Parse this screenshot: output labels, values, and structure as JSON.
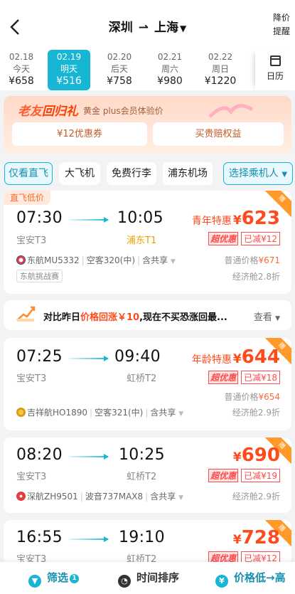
{
  "header": {
    "from": "深圳",
    "to": "上海",
    "price_watch": "降价提醒"
  },
  "dates": [
    {
      "date": "02.18",
      "day": "今天",
      "price": "¥658"
    },
    {
      "date": "02.19",
      "day": "明天",
      "price": "¥516",
      "selected": true
    },
    {
      "date": "02.20",
      "day": "后天",
      "price": "¥758"
    },
    {
      "date": "02.21",
      "day": "周六",
      "price": "¥980"
    },
    {
      "date": "02.22",
      "day": "周日",
      "price": "¥1220"
    }
  ],
  "calendar_label": "日历",
  "promo": {
    "title_a": "老友",
    "title_b": "回归礼",
    "subtitle": "黄金 plus会员体验价",
    "coupon": "¥12优惠券",
    "guarantee": "买贵赔权益"
  },
  "filters": [
    "仅看直飞",
    "大飞机",
    "免费行李",
    "浦东机场"
  ],
  "passenger_select": "选择乘机人",
  "flights": [
    {
      "tag": "直飞低价",
      "dep_time": "07:30",
      "dep_airport": "宝安T3",
      "arr_time": "10:05",
      "arr_airport": "浦东T1",
      "price_label": "青年特惠",
      "price": "623",
      "badge1": "超优惠",
      "badge2": "已减¥12",
      "airline": "东航MU5332",
      "aircraft": "空客320(中)",
      "share": "含共享",
      "normal_label": "普通价格",
      "normal_price": "¥671",
      "cabin": "经济舱2.8折",
      "event": "东航挑战赛",
      "corner": "赠"
    },
    {
      "dep_time": "07:25",
      "dep_airport": "宝安T3",
      "arr_time": "09:40",
      "arr_airport": "虹桥T2",
      "price_label": "年龄特惠",
      "price": "644",
      "badge1": "超优惠",
      "badge2": "已减¥18",
      "airline": "吉祥航HO1890",
      "aircraft": "空客321(中)",
      "share": "含共享",
      "normal_label": "普通价格",
      "normal_price": "¥654",
      "cabin": "经济舱2.9折",
      "corner": "赠"
    },
    {
      "dep_time": "08:20",
      "dep_airport": "宝安T3",
      "arr_time": "10:25",
      "arr_airport": "虹桥T2",
      "price": "690",
      "badge1": "超优惠",
      "badge2": "已减¥19",
      "airline": "深航ZH9501",
      "aircraft": "波音737MAX8",
      "share": "含共享",
      "cabin": "经济舱2.9折",
      "corner": "赠"
    },
    {
      "dep_time": "16:55",
      "dep_airport": "宝安T3",
      "arr_time": "19:10",
      "arr_airport": "虹桥T2",
      "price": "728",
      "badge1": "超优惠",
      "badge2": "已减¥12",
      "corner": "赠"
    }
  ],
  "notice": {
    "prefix": "对比昨日",
    "red": "价格回涨￥10",
    "suffix": ",现在不买恐涨回最...",
    "more": "查看"
  },
  "bottom": {
    "filter": "筛选",
    "filter_count": "1",
    "time_sort": "时间排序",
    "price_sort": "价格低→高"
  },
  "currency": "¥",
  "colors": {
    "accent": "#17b6d5",
    "price": "#ff4a1c"
  }
}
